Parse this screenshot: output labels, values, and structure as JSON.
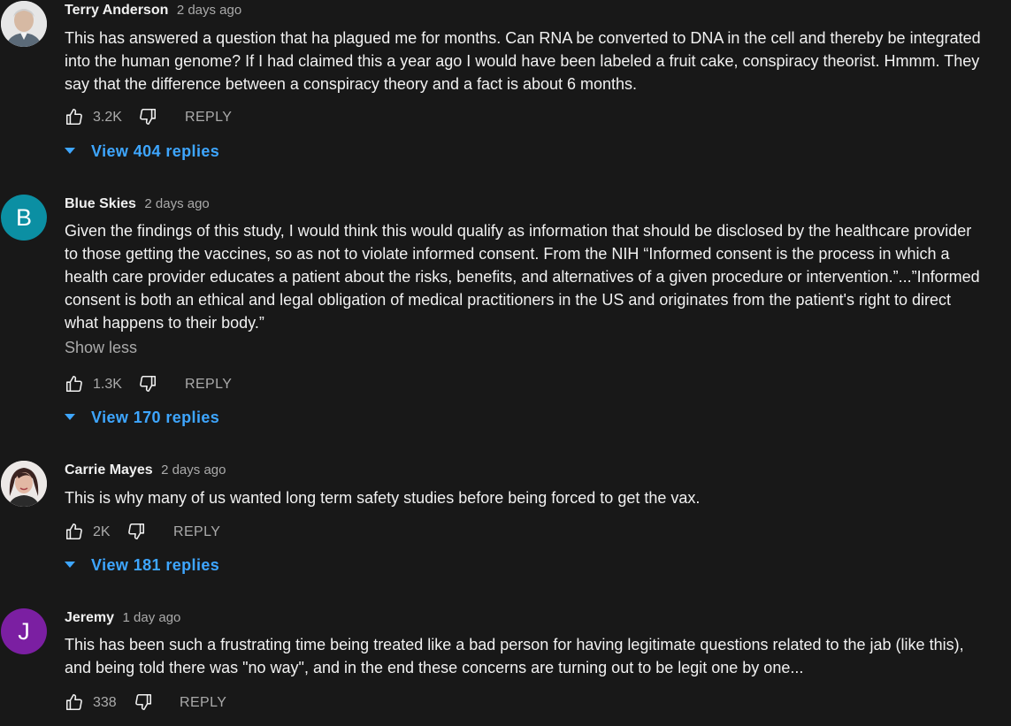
{
  "comments": [
    {
      "author": "Terry Anderson",
      "time": "2 days ago",
      "text": "This has answered a question that ha plagued me for months. Can RNA be converted to DNA in the cell and thereby be integrated into the human genome? If I had claimed this a year ago I would have been labeled a fruit cake, conspiracy theorist. Hmmm. They say that the difference between a conspiracy theory and a fact is about 6 months.",
      "likes": "3.2K",
      "reply_label": "REPLY",
      "view_replies": "View 404 replies",
      "avatar": {
        "type": "photo",
        "bg": "#d9d9d9"
      }
    },
    {
      "author": "Blue Skies",
      "time": "2 days ago",
      "text": "Given the findings of this study, I would think this would qualify as information that should be disclosed by the healthcare provider to those getting the vaccines, so as not to violate  informed consent. From the NIH “Informed consent is the process in which a health care provider educates a patient about the risks, benefits, and alternatives of a given procedure or intervention.”...”Informed consent is both an ethical and legal obligation of medical practitioners in the US and originates from the patient's right to direct what happens to their body.”",
      "show_less": "Show less",
      "likes": "1.3K",
      "reply_label": "REPLY",
      "view_replies": "View 170 replies",
      "avatar": {
        "type": "letter",
        "letter": "B",
        "bg": "#0b8fa3"
      }
    },
    {
      "author": "Carrie Mayes",
      "time": "2 days ago",
      "text": "This is why many of us wanted long term safety studies before being forced to get the vax.",
      "likes": "2K",
      "reply_label": "REPLY",
      "view_replies": "View 181 replies",
      "avatar": {
        "type": "photo",
        "bg": "#e7e2e0"
      }
    },
    {
      "author": "Jeremy",
      "time": "1 day ago",
      "text": "This has been such a frustrating time being treated like a bad person for having legitimate questions related to the jab (like this), and being told there was \"no way\", and in the end these concerns are turning out to be legit one by one...",
      "likes": "338",
      "reply_label": "REPLY",
      "avatar": {
        "type": "letter",
        "letter": "J",
        "bg": "#7b1fa2"
      }
    }
  ],
  "icons": {
    "like": "thumbs-up-icon",
    "dislike": "thumbs-down-icon",
    "expand": "caret-down-icon"
  },
  "colors": {
    "background": "#181818",
    "text": "#f1f1f1",
    "secondary": "#aaaaaa",
    "link": "#3ea6ff"
  }
}
